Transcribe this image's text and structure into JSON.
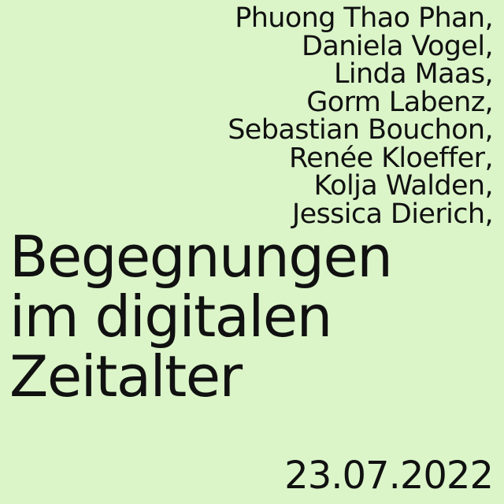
{
  "names": [
    "Phuong Thao Phan,",
    "Daniela Vogel,",
    "Linda Maas,",
    "Gorm Labenz,",
    "Sebastian Bouchon,",
    "Renée Kloeffer,",
    "Kolja Walden,",
    "Jessica Dierich,"
  ],
  "title": {
    "line1": "Begegnungen",
    "line2": "im digitalen",
    "line3": "Zeitalter"
  },
  "date": "23.07.2022",
  "colors": {
    "background": "#dbf5c9",
    "text": "#111111"
  }
}
